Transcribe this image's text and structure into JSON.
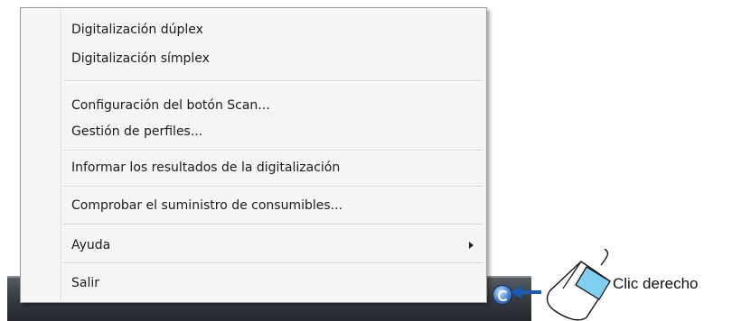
{
  "menu": {
    "items": [
      {
        "label": "Digitalización dúplex"
      },
      {
        "label": "Digitalización símplex"
      },
      {
        "label": "Configuración del botón Scan..."
      },
      {
        "label": "Gestión de perfiles..."
      },
      {
        "label": "Informar los resultados de la digitalización"
      },
      {
        "label": "Comprobar el suministro de consumibles..."
      },
      {
        "label": "Ayuda",
        "has_submenu": true
      },
      {
        "label": "Salir"
      }
    ]
  },
  "annotation": {
    "label": "Clic derecho",
    "arrow_color": "#1a5bb3",
    "button_highlight_color": "#7fd0f0"
  },
  "taskbar": {
    "tray_icon": "scanner-tray-icon"
  }
}
